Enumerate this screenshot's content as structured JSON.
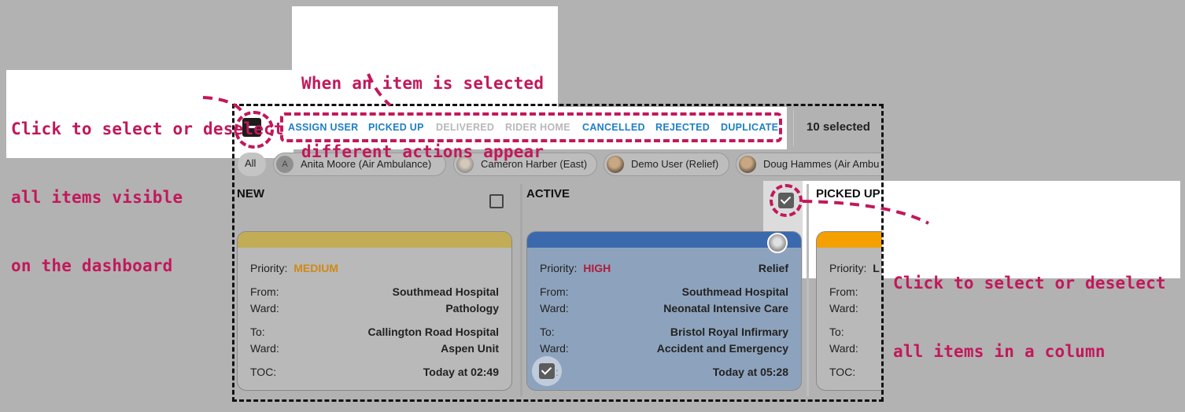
{
  "annotations": {
    "item_selected": [
      "When an item is selected",
      "different actions appear"
    ],
    "select_all": [
      "Click to select or deselect",
      "all items visible",
      "on the dashboard"
    ],
    "select_column": [
      "Click to select or deselect",
      "all items in a column"
    ]
  },
  "toolbar": {
    "actions": [
      {
        "label": "ASSIGN USER",
        "enabled": true
      },
      {
        "label": "PICKED UP",
        "enabled": true
      },
      {
        "label": "DELIVERED",
        "enabled": false
      },
      {
        "label": "RIDER HOME",
        "enabled": false
      },
      {
        "label": "CANCELLED",
        "enabled": true
      },
      {
        "label": "REJECTED",
        "enabled": true
      },
      {
        "label": "DUPLICATE",
        "enabled": true
      }
    ],
    "selected_count": "10 selected"
  },
  "filter_chips": [
    {
      "label": "All",
      "avatar": "none"
    },
    {
      "label": "Anita Moore (Air Ambulance)",
      "avatar": "A"
    },
    {
      "label": "Cameron Harber (East)",
      "avatar": "photo"
    },
    {
      "label": "Demo User (Relief)",
      "avatar": "photo"
    },
    {
      "label": "Doug Hammes (Air Ambu",
      "avatar": "photo"
    }
  ],
  "columns": [
    {
      "title": "NEW",
      "checked": false
    },
    {
      "title": "ACTIVE",
      "checked": true
    },
    {
      "title": "PICKED UP",
      "checked": false
    }
  ],
  "cards": [
    {
      "band_color": "#c2ac55",
      "priority_label": "Priority:",
      "priority": "MEDIUM",
      "from_label": "From:",
      "from": "Southmead Hospital",
      "from_ward_label": "Ward:",
      "from_ward": "Pathology",
      "to_label": "To:",
      "to": "Callington Road Hospital",
      "to_ward_label": "Ward:",
      "to_ward": "Aspen Unit",
      "toc_label": "TOC:",
      "toc": "Today at 02:49"
    },
    {
      "band_color": "#3a69ad",
      "priority_label": "Priority:",
      "priority": "HIGH",
      "assignee": "Relief",
      "from_label": "From:",
      "from": "Southmead Hospital",
      "from_ward_label": "Ward:",
      "from_ward": "Neonatal Intensive Care",
      "to_label": "To:",
      "to": "Bristol Royal Infirmary",
      "to_ward_label": "Ward:",
      "to_ward": "Accident and Emergency",
      "toc_label": ":",
      "toc": "Today at 05:28"
    },
    {
      "band_color": "#f4a000",
      "priority_label": "Priority:",
      "priority": "L",
      "from_label": "From:",
      "from_ward_label": "Ward:",
      "to_label": "To:",
      "to_ward_label": "Ward:",
      "toc_label": "TOC:"
    }
  ],
  "colors": {
    "accent": "#c2185b",
    "action_enabled": "#1e7ec8",
    "action_disabled": "#b8b8b8"
  },
  "icons": [
    "master-indeterminate-checkbox-icon",
    "column-checkbox-icon",
    "card-checkbox-icon",
    "user-avatar-icon"
  ]
}
